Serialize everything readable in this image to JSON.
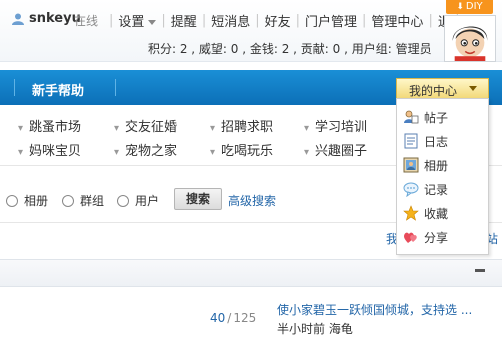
{
  "header": {
    "username": "snkeyu",
    "online": "在线",
    "links": [
      "设置",
      "提醒",
      "短消息",
      "好友",
      "门户管理",
      "管理中心",
      "退出"
    ],
    "stats": "积分: 2 , 威望: 0 , 金钱: 2 , 贡献: 0 , 用户组: 管理员",
    "diy": "DIY"
  },
  "nav": {
    "help": "新手帮助",
    "my_center": "我的中心"
  },
  "categories": [
    "跳蚤市场",
    "交友征婚",
    "招聘求职",
    "学习培训",
    "妈咪宝贝",
    "宠物之家",
    "吃喝玩乐",
    "兴趣圈子"
  ],
  "search": {
    "options": [
      "相册",
      "群组",
      "用户"
    ],
    "button": "搜索",
    "advanced": "高级搜索"
  },
  "cut_texts": {
    "left": "我",
    "right": "站"
  },
  "thread": {
    "replies": "40",
    "views": "125",
    "title": "使小家碧玉一跃倾国倾城，支持选 ...",
    "meta": "半小时前 海龟"
  },
  "menu": {
    "items": [
      {
        "label": "帖子",
        "icon": "post-icon"
      },
      {
        "label": "日志",
        "icon": "blog-icon"
      },
      {
        "label": "相册",
        "icon": "album-icon"
      },
      {
        "label": "记录",
        "icon": "record-icon"
      },
      {
        "label": "收藏",
        "icon": "star-icon"
      },
      {
        "label": "分享",
        "icon": "share-icon"
      }
    ]
  },
  "colors": {
    "nav_blue": "#0c6fb7",
    "link_blue": "#2366a8",
    "diy_orange": "#f7941d",
    "menu_gold": "#f2d97a"
  }
}
